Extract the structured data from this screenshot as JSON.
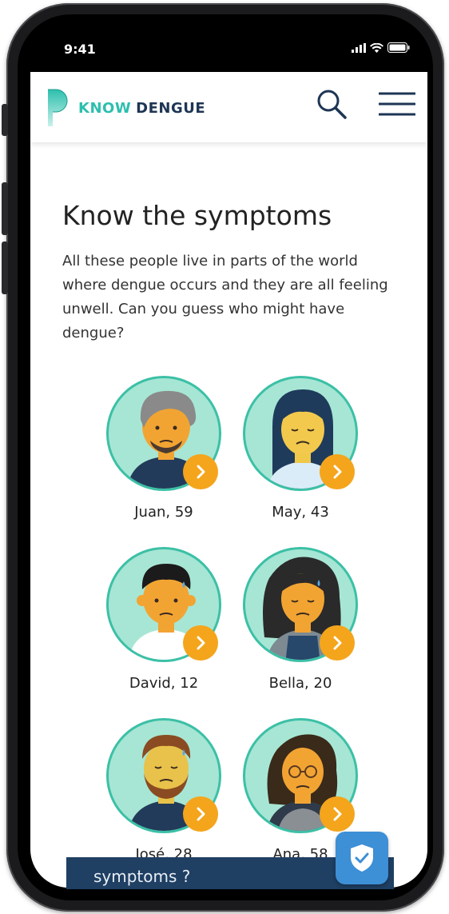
{
  "status": {
    "time": "9:41"
  },
  "header": {
    "logo_word1": "KNOW",
    "logo_word2": "DENGUE",
    "brand_teal": "#2dbfae",
    "brand_navy": "#1e3554"
  },
  "main": {
    "title": "Know the symptoms",
    "description": "All these people live in parts of the world where dengue occurs and they are all feeling unwell. Can you guess who might have dengue?",
    "people": [
      {
        "label": "Juan, 59",
        "icon": "avatar-juan"
      },
      {
        "label": "May, 43",
        "icon": "avatar-may"
      },
      {
        "label": "David, 12",
        "icon": "avatar-david"
      },
      {
        "label": "Bella, 20",
        "icon": "avatar-bella"
      },
      {
        "label": "José, 28",
        "icon": "avatar-jose"
      },
      {
        "label": "Ana, 58",
        "icon": "avatar-ana"
      }
    ]
  },
  "banner": {
    "text": "symptoms ?"
  },
  "colors": {
    "avatar_bg": "#a7e6d4",
    "avatar_border": "#3cc0a6",
    "chevron": "#f4a51c",
    "banner": "#1f3f63",
    "shield": "#3d8fd6"
  }
}
